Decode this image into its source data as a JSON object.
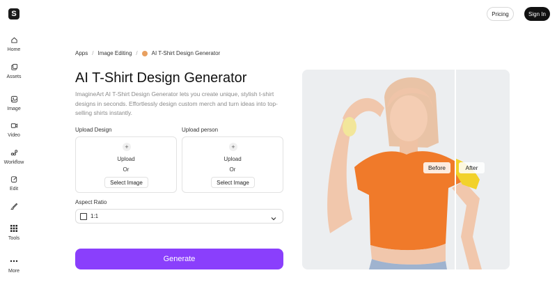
{
  "brand": {
    "logo_letter": "S"
  },
  "sidebar": {
    "items": [
      {
        "label": "Home",
        "icon": "home-icon"
      },
      {
        "label": "Assets",
        "icon": "assets-icon"
      },
      {
        "label": "Image",
        "icon": "image-icon"
      },
      {
        "label": "Video",
        "icon": "video-icon"
      },
      {
        "label": "Workflow",
        "icon": "workflow-icon"
      },
      {
        "label": "Edit",
        "icon": "edit-icon"
      },
      {
        "label": "",
        "icon": "brush-icon"
      },
      {
        "label": "Tools",
        "icon": "grid-icon"
      },
      {
        "label": "More",
        "icon": "more-icon"
      }
    ]
  },
  "topbar": {
    "pricing": "Pricing",
    "signin": "Sign In"
  },
  "breadcrumb": {
    "apps": "Apps",
    "image_editing": "Image Editing",
    "current": "AI T-Shirt Design Generator",
    "sep": "/"
  },
  "main": {
    "title": "AI T-Shirt Design Generator",
    "description": "ImagineArt AI T-Shirt Design Generator lets you create unique, stylish t-shirt designs in seconds. Effortlessly design custom merch and turn ideas into top-selling shirts instantly.",
    "upload_design": {
      "label": "Upload Design",
      "upload": "Upload",
      "or": "Or",
      "select": "Select  Image"
    },
    "upload_person": {
      "label": "Upload person",
      "upload": "Upload",
      "or": "Or",
      "select": "Select  Image"
    },
    "aspect_ratio": {
      "label": "Aspect Ratio",
      "value": "1:1"
    },
    "generate": "Generate"
  },
  "preview": {
    "before": "Before",
    "after": "After"
  },
  "colors": {
    "accent": "#8a3ffc",
    "shirt_before": "#f07a2a",
    "shirt_after": "#f2d22a",
    "signin_bg": "#111111"
  }
}
